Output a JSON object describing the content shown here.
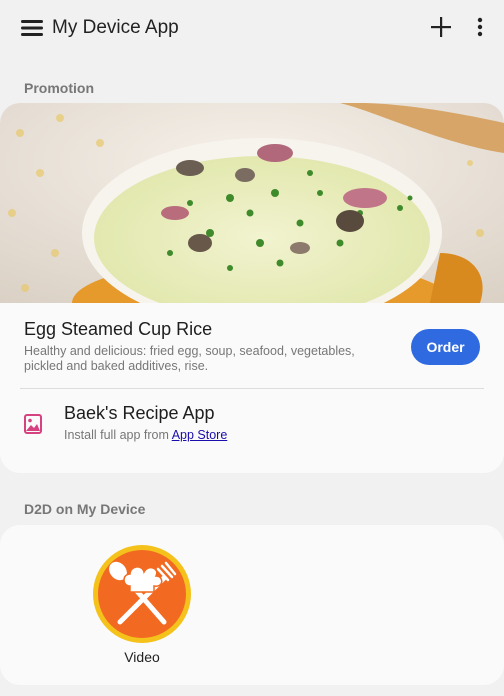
{
  "app_bar": {
    "title": "My Device App",
    "menu_icon": "hamburger-menu-icon",
    "add_icon": "plus-icon",
    "more_icon": "more-vertical-icon"
  },
  "promotion": {
    "section_label": "Promotion",
    "image": "egg-steamed-rice-photo",
    "title": "Egg Steamed Cup Rice",
    "description": "Healthy and delicious: fried egg, soup, seafood, vegetables, pickled and baked additives, rise.",
    "order_label": "Order",
    "app_icon": "image-icon",
    "app_title": "Baek's Recipe App",
    "install_text": "Install full app from ",
    "store_link": "App Store"
  },
  "d2d": {
    "section_label": "D2D on My Device",
    "item_icon": "chef-hat-utensils-icon",
    "item_label": "Video"
  },
  "colors": {
    "accent": "#2f6ae0",
    "background": "#f1f1f1",
    "card": "#fafafa",
    "video_icon_orange": "#f26a21",
    "video_icon_ring": "#f4c21b"
  }
}
